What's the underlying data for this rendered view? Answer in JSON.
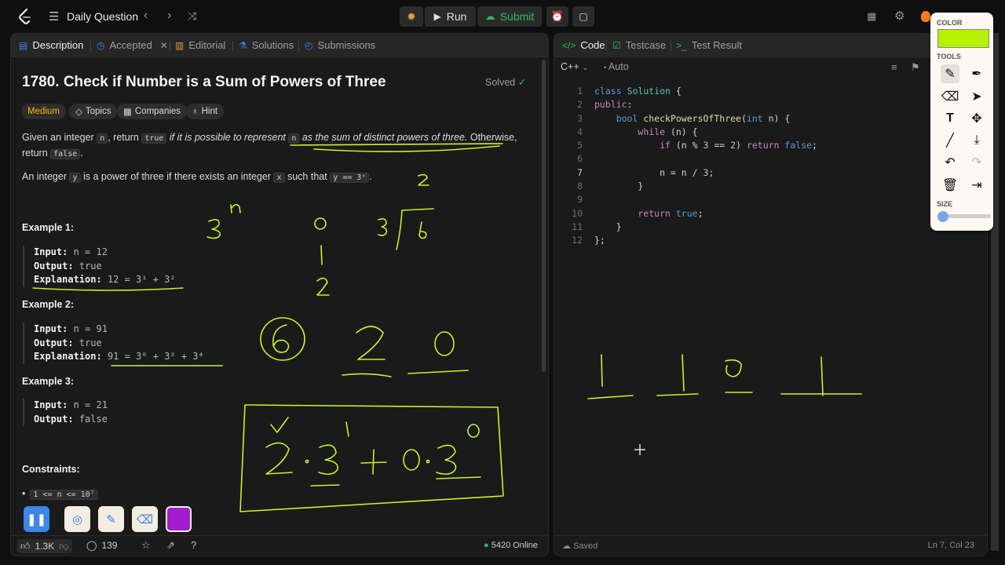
{
  "nav": {
    "title": "Daily Question",
    "run": "Run",
    "submit": "Submit"
  },
  "left_tabs": [
    "Description",
    "Accepted",
    "Editorial",
    "Solutions",
    "Submissions"
  ],
  "problem": {
    "title": "1780. Check if Number is a Sum of Powers of Three",
    "status": "Solved",
    "difficulty": "Medium",
    "tags": [
      "Topics",
      "Companies",
      "Hint"
    ],
    "p1": {
      "a": "Given an integer ",
      "c1": "n",
      "b": ", return ",
      "c2": "true",
      "d": " if it is possible to represent ",
      "c3": "n",
      "e": " as the sum of distinct powers of three.",
      "f": " Otherwise,",
      "g": "return ",
      "c4": "false",
      "h": "."
    },
    "p2": {
      "a": "An integer ",
      "c1": "y",
      "b": " is a power of three if there exists an integer ",
      "c2": "x",
      "d": " such that ",
      "c3": "y == 3ˣ",
      "e": "."
    },
    "examples": [
      {
        "heading": "Example 1:",
        "input_label": "Input:",
        "input": "n = 12",
        "output_label": "Output:",
        "output": "true",
        "expl_label": "Explanation:",
        "expl": "12 = 3¹ + 3²"
      },
      {
        "heading": "Example 2:",
        "input_label": "Input:",
        "input": "n = 91",
        "output_label": "Output:",
        "output": "true",
        "expl_label": "Explanation:",
        "expl": "91 = 3⁰ + 3² + 3⁴"
      },
      {
        "heading": "Example 3:",
        "input_label": "Input:",
        "input": "n = 21",
        "output_label": "Output:",
        "output": "false"
      }
    ],
    "constraints_heading": "Constraints:",
    "constraint": "1 <= n <= 10⁷"
  },
  "footer": {
    "likes": "1.3K",
    "comments": "139",
    "online": "5420 Online"
  },
  "right_tabs": [
    "Code",
    "Testcase",
    "Test Result"
  ],
  "editor": {
    "language": "C++",
    "mode": "Auto",
    "line_numbers": [
      "1",
      "2",
      "3",
      "4",
      "5",
      "6",
      "7",
      "8",
      "9",
      "10",
      "11",
      "12"
    ],
    "status": "Saved",
    "cursor": "Ln 7, Col 23"
  },
  "palette": {
    "color_label": "COLOR",
    "tools_label": "TOOLS",
    "size_label": "SIZE",
    "current_color": "#b7f000"
  },
  "colors": {
    "accent_green": "#2cbb5d",
    "medium": "#ffb800",
    "ink": "#c6f32a",
    "record_purple": "#a21ccf"
  }
}
